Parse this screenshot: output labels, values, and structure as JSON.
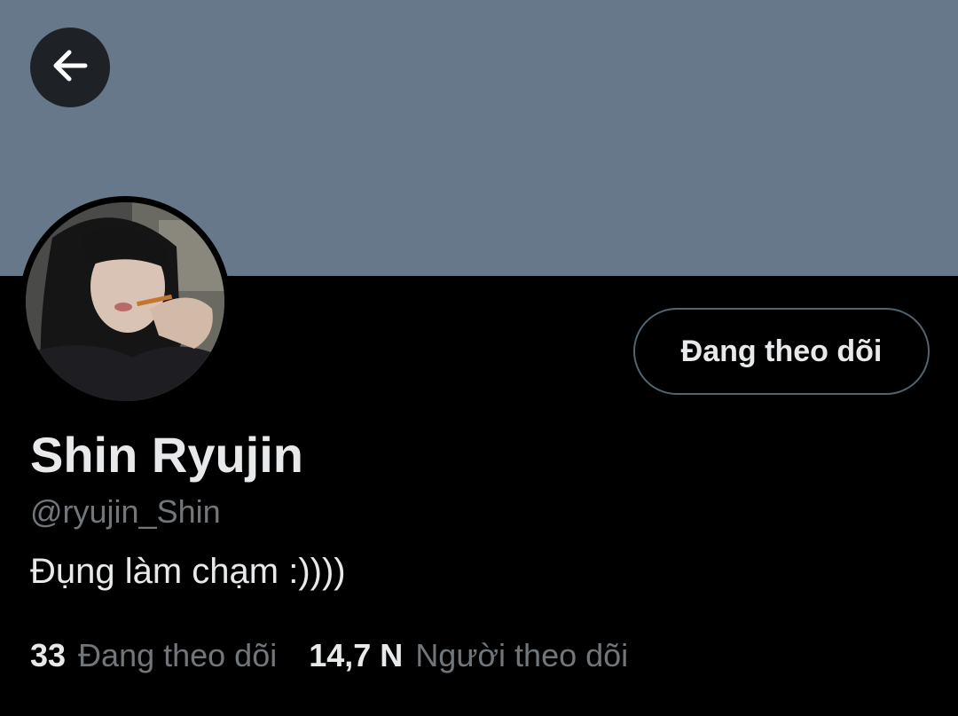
{
  "header": {
    "back_icon": "arrow-left-icon",
    "banner_color": "#66788a"
  },
  "profile": {
    "avatar_icon": "profile-photo",
    "display_name": "Shin Ryujin",
    "handle": "@ryujin_Shin",
    "bio": "Đụng làm chạm :))))",
    "follow_button_label": "Đang theo dõi"
  },
  "stats": {
    "following_count": "33",
    "following_label": "Đang theo dõi",
    "followers_count": "14,7 N",
    "followers_label": "Người theo dõi"
  },
  "colors": {
    "background": "#000000",
    "text_primary": "#e7e9ea",
    "text_secondary": "#71767b",
    "border": "#536471"
  }
}
